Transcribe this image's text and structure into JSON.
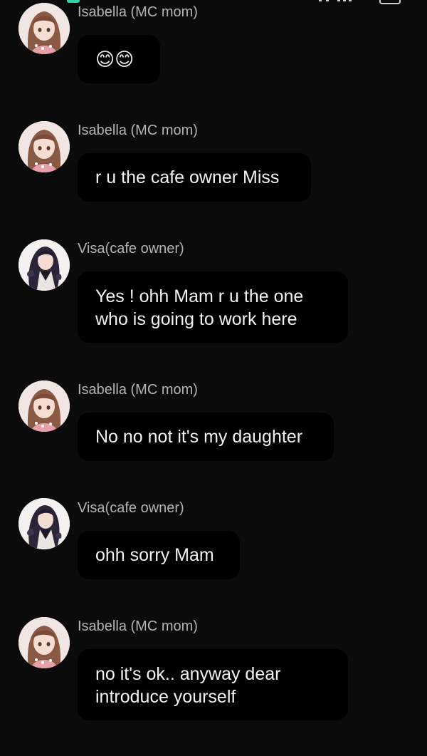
{
  "conversation": {
    "messages": [
      {
        "sender": "Isabella (MC mom)",
        "text": "😊😊",
        "avatar": "isabella-avatar"
      },
      {
        "sender": "Isabella (MC mom)",
        "text": "r u the cafe owner Miss",
        "avatar": "isabella-avatar"
      },
      {
        "sender": "Visa(cafe owner)",
        "text": "Yes ! ohh Mam r u the one who is going to work here",
        "avatar": "visa-avatar"
      },
      {
        "sender": "Isabella (MC mom)",
        "text": "No no not it's my daughter",
        "avatar": "isabella-avatar"
      },
      {
        "sender": "Visa(cafe owner)",
        "text": "ohh sorry Mam",
        "avatar": "visa-avatar"
      },
      {
        "sender": "Isabella (MC mom)",
        "text": "no it's ok.. anyway dear introduce yourself",
        "avatar": "isabella-avatar"
      }
    ]
  },
  "colors": {
    "background": "#0b0b0b",
    "bubble": "#000000",
    "sender_name": "#b4b4b4",
    "message_text": "#f2f2f2"
  }
}
